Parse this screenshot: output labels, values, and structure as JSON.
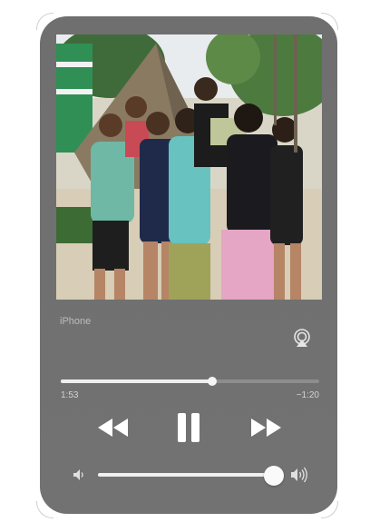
{
  "output": {
    "device_label": "iPhone"
  },
  "playback": {
    "elapsed": "1:53",
    "remaining": "−1:20",
    "progress_fraction": 0.585
  },
  "volume": {
    "level_fraction": 0.97
  },
  "icons": {
    "output": "airplay-audio-icon",
    "rewind": "backward-icon",
    "pause": "pause-icon",
    "forward": "forward-icon",
    "volume_low": "speaker-low-icon",
    "volume_high": "speaker-high-icon"
  },
  "colors": {
    "panel": "#707070",
    "accent": "#f0f0f0",
    "track": "#8d8d8d"
  }
}
